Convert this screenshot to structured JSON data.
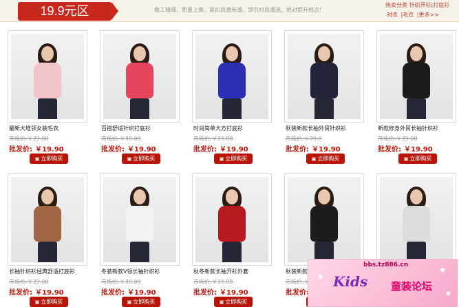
{
  "header": {
    "banner": "19.9元区",
    "slogan": "做工精细、质量上乘、紧扣尚激新潮、领引时尚潮流、绝对提升档次!",
    "hot_title": "热卖分类 针织开衫|打底衫",
    "hot_links": [
      "衬衣",
      "|毛衣",
      "|更多>>"
    ]
  },
  "labels": {
    "market_prefix": "市场价:",
    "wholesale_prefix": "批发价:",
    "buy": "立即购买"
  },
  "products": [
    {
      "title": "最新大堆领女装毛衣",
      "market_price": "￥39.00",
      "price": "￥19.90",
      "color": "#f1c4c9"
    },
    {
      "title": "百搭舒适针织打底衫",
      "market_price": "￥39.00",
      "price": "￥19.90",
      "color": "#e5465d"
    },
    {
      "title": "时尚简单大方打底衫",
      "market_price": "￥39.00",
      "price": "￥19.90",
      "color": "#2b2fb4"
    },
    {
      "title": "秋装新款长袖外贸针织衫",
      "market_price": "￥39.0",
      "price": "￥19.90",
      "color": "#23233a"
    },
    {
      "title": "新款修身外贸长袖针织衫",
      "market_price": "￥39.00",
      "price": "￥19.90",
      "color": "#1b1b1b"
    },
    {
      "title": "长袖针织衫经典舒适打底衫",
      "market_price": "￥39.00",
      "price": "￥19.90",
      "color": "#a06545"
    },
    {
      "title": "冬装新款V领长袖针织衫",
      "market_price": "￥39.00",
      "price": "￥19.90",
      "color": "#f3f3f3"
    },
    {
      "title": "秋冬新款长袖开衫外套",
      "market_price": "￥39.00",
      "price": "￥19.90",
      "color": "#b71b21"
    },
    {
      "title": "秋装新款",
      "market_price": "￥39.00",
      "price": "￥19.90",
      "color": "#1c1c1c"
    },
    {
      "title": "",
      "market_price": "",
      "price": "",
      "color": "#dcdcdc"
    }
  ],
  "ad": {
    "url": "bbs.tz886.cn",
    "kids": "Kids",
    "forum": "童装论坛"
  }
}
